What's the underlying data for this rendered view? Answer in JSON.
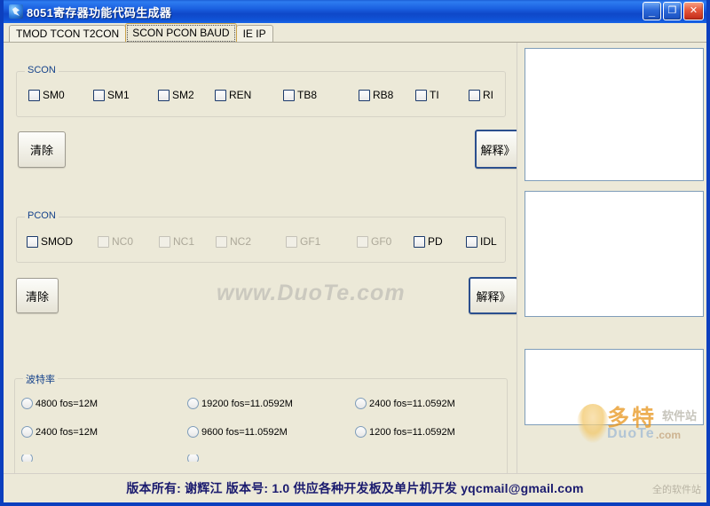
{
  "window": {
    "title": "8051寄存器功能代码生成器",
    "icon": "app-icon",
    "caption": {
      "minimize": "_",
      "maximize": "❐",
      "close": "✕"
    }
  },
  "tabs": [
    {
      "label": "TMOD TCON T2CON",
      "selected": false
    },
    {
      "label": "SCON PCON BAUD",
      "selected": true
    },
    {
      "label": "IE IP",
      "selected": false
    }
  ],
  "scon": {
    "title": "SCON",
    "checkboxes": [
      {
        "label": "SM0",
        "checked": false,
        "disabled": false
      },
      {
        "label": "SM1",
        "checked": false,
        "disabled": false
      },
      {
        "label": "SM2",
        "checked": false,
        "disabled": false
      },
      {
        "label": "REN",
        "checked": false,
        "disabled": false
      },
      {
        "label": "TB8",
        "checked": false,
        "disabled": false
      },
      {
        "label": "RB8",
        "checked": false,
        "disabled": false
      },
      {
        "label": "TI",
        "checked": false,
        "disabled": false
      },
      {
        "label": "RI",
        "checked": false,
        "disabled": false
      }
    ],
    "clear_label": "清除",
    "explain_label": "解释》"
  },
  "pcon": {
    "title": "PCON",
    "checkboxes": [
      {
        "label": "SMOD",
        "checked": false,
        "disabled": false
      },
      {
        "label": "NC0",
        "checked": false,
        "disabled": true
      },
      {
        "label": "NC1",
        "checked": false,
        "disabled": true
      },
      {
        "label": "NC2",
        "checked": false,
        "disabled": true
      },
      {
        "label": "GF1",
        "checked": false,
        "disabled": true
      },
      {
        "label": "GF0",
        "checked": false,
        "disabled": true
      },
      {
        "label": "PD",
        "checked": false,
        "disabled": false
      },
      {
        "label": "IDL",
        "checked": false,
        "disabled": false
      }
    ],
    "clear_label": "清除",
    "explain_label": "解释》"
  },
  "baud": {
    "title": "波特率",
    "radios": [
      {
        "label": "4800 fos=12M",
        "col": 0,
        "row": 0,
        "selected": false
      },
      {
        "label": "19200 fos=11.0592M",
        "col": 1,
        "row": 0,
        "selected": false
      },
      {
        "label": "2400   fos=11.0592M",
        "col": 2,
        "row": 0,
        "selected": false
      },
      {
        "label": "2400 fos=12M",
        "col": 0,
        "row": 1,
        "selected": false
      },
      {
        "label": "9600   fos=11.0592M",
        "col": 1,
        "row": 1,
        "selected": false
      },
      {
        "label": "1200   fos=11.0592M",
        "col": 2,
        "row": 1,
        "selected": false
      }
    ]
  },
  "output": {
    "scon_text": "",
    "pcon_text": "",
    "baud_text": ""
  },
  "footer": {
    "text": "版本所有: 谢辉江  版本号: 1.0    供应各种开发板及单片机开发  yqcmail@gmail.com"
  },
  "watermark": {
    "center": "www.DuoTe.com",
    "logo_cn": "多特",
    "logo_cn2": "软件站",
    "logo_en": "DuoTe",
    "logo_en2": ".com",
    "footer_right": "全的软件站"
  },
  "colors": {
    "titlebar": "#0f47c8",
    "frame": "#0c3fbe",
    "face": "#ece9d8",
    "group_title": "#15428b",
    "footer_text": "#1a1a6e"
  }
}
